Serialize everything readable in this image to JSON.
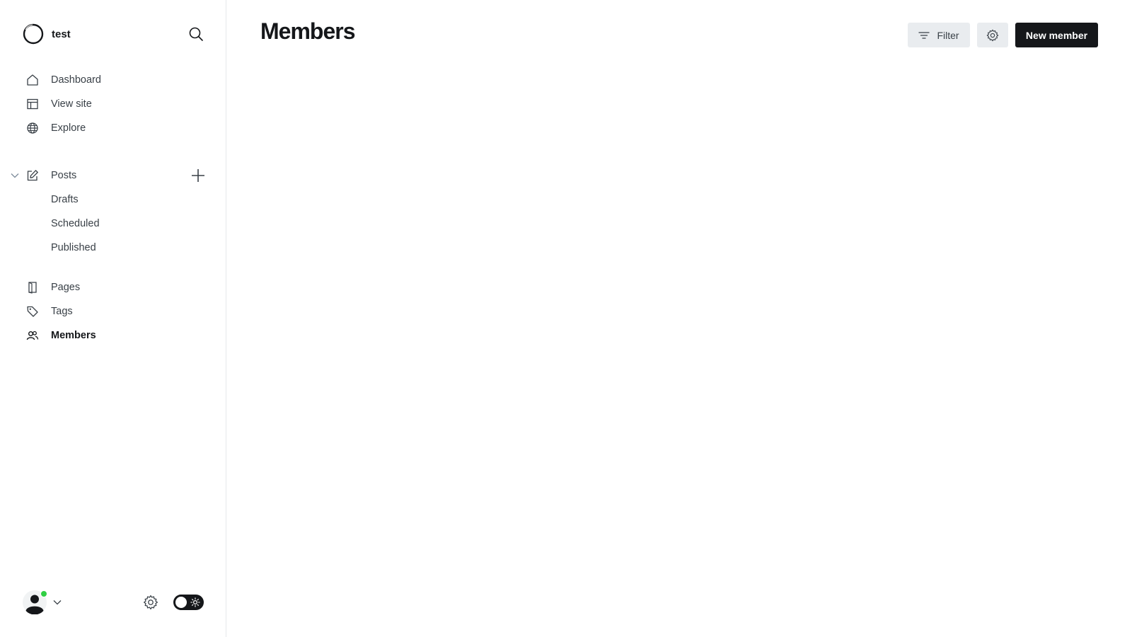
{
  "brand": {
    "name": "test",
    "logo_icon": "ghost-ring-logo"
  },
  "sidebar": {
    "primary": [
      {
        "label": "Dashboard",
        "icon": "home-icon"
      },
      {
        "label": "View site",
        "icon": "layout-icon"
      },
      {
        "label": "Explore",
        "icon": "globe-icon"
      }
    ],
    "posts": {
      "label": "Posts",
      "icon": "pencil-square-icon",
      "sub_items": [
        "Drafts",
        "Scheduled",
        "Published"
      ]
    },
    "secondary": [
      {
        "label": "Pages",
        "icon": "page-icon"
      },
      {
        "label": "Tags",
        "icon": "tag-icon"
      },
      {
        "label": "Members",
        "icon": "members-icon",
        "active": true
      }
    ]
  },
  "main": {
    "title": "Members",
    "toolbar": {
      "filter_label": "Filter",
      "new_member_label": "New member"
    }
  },
  "colors": {
    "text": "#15171a",
    "muted_text": "#394047",
    "button_gray": "#e9ecef",
    "primary_button": "#15171a",
    "online_dot": "#30cf43",
    "border": "#e6e9eb"
  }
}
